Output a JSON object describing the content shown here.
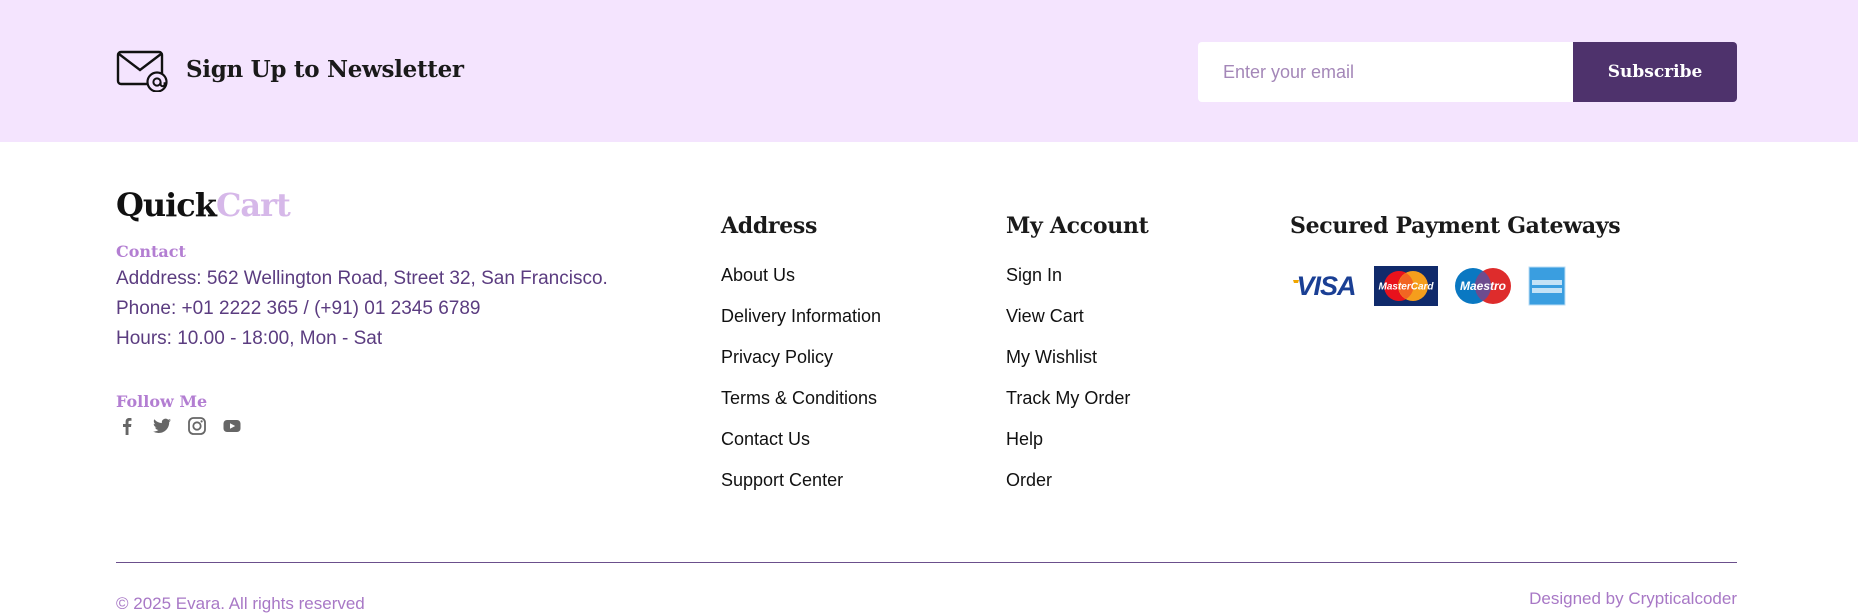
{
  "newsletter": {
    "title": "Sign Up to Newsletter",
    "email_placeholder": "Enter your email",
    "subscribe_label": "Subscribe",
    "icon": "mail-at-icon"
  },
  "brand": {
    "part1": "Quick",
    "part2": "Cart"
  },
  "contact": {
    "heading": "Contact",
    "address": "Adddress: 562 Wellington Road, Street 32, San Francisco.",
    "phone": "Phone: +01 2222 365 / (+91) 01 2345 6789",
    "hours": "Hours: 10.00 - 18:00, Mon - Sat"
  },
  "follow": {
    "heading": "Follow Me",
    "icons": [
      "facebook-icon",
      "twitter-icon",
      "instagram-icon",
      "youtube-icon"
    ]
  },
  "address_col": {
    "heading": "Address",
    "items": [
      "About Us",
      "Delivery Information",
      "Privacy Policy",
      "Terms & Conditions",
      "Contact Us",
      "Support Center"
    ]
  },
  "account_col": {
    "heading": "My Account",
    "items": [
      "Sign In",
      "View Cart",
      "My Wishlist",
      "Track My Order",
      "Help",
      "Order"
    ]
  },
  "payments": {
    "heading": "Secured Payment Gateways",
    "cards": [
      "visa-icon",
      "mastercard-icon",
      "maestro-icon",
      "american-express-icon"
    ]
  },
  "footer": {
    "copyright": "© 2025 Evara. All rights reserved",
    "designed_by": "Designed by Crypticalcoder"
  },
  "colors": {
    "newsletter_bg": "#f4e4fe",
    "accent_dark": "#4e326c",
    "accent_light": "#d6b8e9",
    "link_purple": "#a878c6"
  }
}
